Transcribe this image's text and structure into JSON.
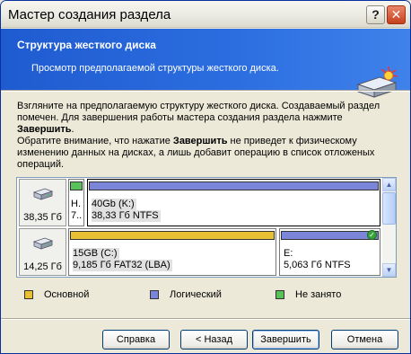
{
  "window": {
    "title": "Мастер создания раздела",
    "help_glyph": "?",
    "close_glyph": "✕"
  },
  "header": {
    "title": "Структура жесткого диска",
    "subtitle": "Просмотр предполагаемой структуры жесткого диска."
  },
  "description": {
    "line1": "Взгляните на предполагаемую структуру жесткого диска. Создаваемый раздел",
    "line2": "помечен. Для завершения работы мастера создания раздела нажмите",
    "line3_bold": "Завершить",
    "line3_rest": ".",
    "line4_pre": "Обратите внимание, что нажатие ",
    "line4_bold": "Завершить",
    "line4_post": " не приведет к физическому",
    "line5": "изменению данных на дисках, а лишь добавит операцию в список отложеных",
    "line6": "операций."
  },
  "disks": [
    {
      "size": "38,35 Гб",
      "partitions": [
        {
          "type": "free",
          "line1": "Н.",
          "line2": "7.."
        },
        {
          "type": "logical",
          "line1": "40Gb (K:)",
          "line2": "38,33 Гб  NTFS",
          "highlight": true
        }
      ]
    },
    {
      "size": "14,25 Гб",
      "partitions": [
        {
          "type": "primary",
          "line1": "15GB (C:)",
          "line2": "9,185 Гб  FAT32 (LBA)",
          "highlight": true
        },
        {
          "type": "logical",
          "line1": "E:",
          "line2": "5,063 Гб  NTFS",
          "marked": true
        }
      ]
    }
  ],
  "scroll": {
    "up_glyph": "▲",
    "down_glyph": "▼"
  },
  "legend": [
    {
      "label": "Основной",
      "color": "#e8c034"
    },
    {
      "label": "Логический",
      "color": "#7b86d8"
    },
    {
      "label": "Не занято",
      "color": "#58c15a"
    }
  ],
  "buttons": {
    "help": "Справка",
    "back": "< Назад",
    "finish": "Завершить",
    "cancel": "Отмена"
  }
}
